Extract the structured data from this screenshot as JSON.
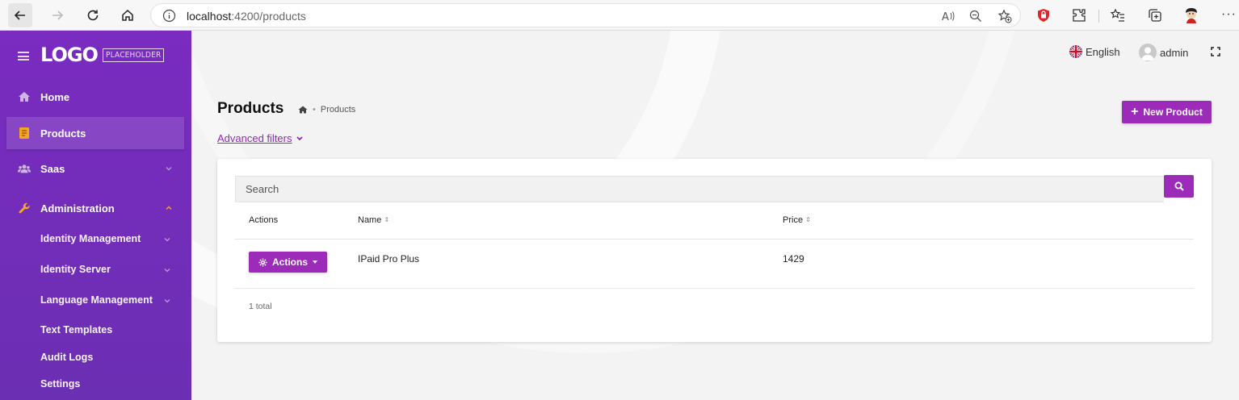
{
  "browser": {
    "url_host": "localhost",
    "url_path": ":4200/products"
  },
  "sidebar": {
    "logo_main": "LOGO",
    "logo_sub": "PLACEHOLDER",
    "items": [
      {
        "label": "Home",
        "icon": "home-icon"
      },
      {
        "label": "Products",
        "icon": "book-icon"
      },
      {
        "label": "Saas",
        "icon": "users-icon"
      },
      {
        "label": "Administration",
        "icon": "wrench-icon"
      }
    ],
    "admin_subitems": [
      {
        "label": "Identity Management"
      },
      {
        "label": "Identity Server"
      },
      {
        "label": "Language Management"
      },
      {
        "label": "Text Templates"
      },
      {
        "label": "Audit Logs"
      },
      {
        "label": "Settings"
      }
    ]
  },
  "topbar": {
    "language": "English",
    "user": "admin"
  },
  "page": {
    "title": "Products",
    "breadcrumb_current": "Products",
    "new_button": "New Product",
    "advanced_filters": "Advanced filters"
  },
  "table": {
    "search_placeholder": "Search",
    "columns": [
      "Actions",
      "Name",
      "Price"
    ],
    "rows": [
      {
        "action_label": "Actions",
        "name": "IPaid Pro Plus",
        "price": "1429"
      }
    ],
    "total_text": "1 total"
  },
  "colors": {
    "sidebar": "#7a2bc0",
    "accent": "#9b2bb8"
  }
}
